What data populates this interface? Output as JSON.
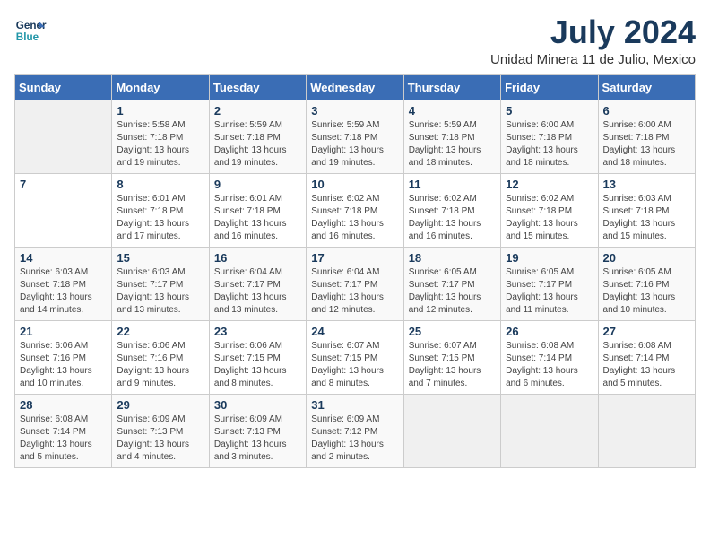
{
  "header": {
    "logo_line1": "General",
    "logo_line2": "Blue",
    "month_title": "July 2024",
    "location": "Unidad Minera 11 de Julio, Mexico"
  },
  "weekdays": [
    "Sunday",
    "Monday",
    "Tuesday",
    "Wednesday",
    "Thursday",
    "Friday",
    "Saturday"
  ],
  "weeks": [
    [
      {
        "day": "",
        "info": ""
      },
      {
        "day": "1",
        "info": "Sunrise: 5:58 AM\nSunset: 7:18 PM\nDaylight: 13 hours\nand 19 minutes."
      },
      {
        "day": "2",
        "info": "Sunrise: 5:59 AM\nSunset: 7:18 PM\nDaylight: 13 hours\nand 19 minutes."
      },
      {
        "day": "3",
        "info": "Sunrise: 5:59 AM\nSunset: 7:18 PM\nDaylight: 13 hours\nand 19 minutes."
      },
      {
        "day": "4",
        "info": "Sunrise: 5:59 AM\nSunset: 7:18 PM\nDaylight: 13 hours\nand 18 minutes."
      },
      {
        "day": "5",
        "info": "Sunrise: 6:00 AM\nSunset: 7:18 PM\nDaylight: 13 hours\nand 18 minutes."
      },
      {
        "day": "6",
        "info": "Sunrise: 6:00 AM\nSunset: 7:18 PM\nDaylight: 13 hours\nand 18 minutes."
      }
    ],
    [
      {
        "day": "7",
        "info": ""
      },
      {
        "day": "8",
        "info": "Sunrise: 6:01 AM\nSunset: 7:18 PM\nDaylight: 13 hours\nand 17 minutes."
      },
      {
        "day": "9",
        "info": "Sunrise: 6:01 AM\nSunset: 7:18 PM\nDaylight: 13 hours\nand 16 minutes."
      },
      {
        "day": "10",
        "info": "Sunrise: 6:02 AM\nSunset: 7:18 PM\nDaylight: 13 hours\nand 16 minutes."
      },
      {
        "day": "11",
        "info": "Sunrise: 6:02 AM\nSunset: 7:18 PM\nDaylight: 13 hours\nand 16 minutes."
      },
      {
        "day": "12",
        "info": "Sunrise: 6:02 AM\nSunset: 7:18 PM\nDaylight: 13 hours\nand 15 minutes."
      },
      {
        "day": "13",
        "info": "Sunrise: 6:03 AM\nSunset: 7:18 PM\nDaylight: 13 hours\nand 15 minutes."
      }
    ],
    [
      {
        "day": "14",
        "info": "Sunrise: 6:03 AM\nSunset: 7:18 PM\nDaylight: 13 hours\nand 14 minutes."
      },
      {
        "day": "15",
        "info": "Sunrise: 6:03 AM\nSunset: 7:17 PM\nDaylight: 13 hours\nand 13 minutes."
      },
      {
        "day": "16",
        "info": "Sunrise: 6:04 AM\nSunset: 7:17 PM\nDaylight: 13 hours\nand 13 minutes."
      },
      {
        "day": "17",
        "info": "Sunrise: 6:04 AM\nSunset: 7:17 PM\nDaylight: 13 hours\nand 12 minutes."
      },
      {
        "day": "18",
        "info": "Sunrise: 6:05 AM\nSunset: 7:17 PM\nDaylight: 13 hours\nand 12 minutes."
      },
      {
        "day": "19",
        "info": "Sunrise: 6:05 AM\nSunset: 7:17 PM\nDaylight: 13 hours\nand 11 minutes."
      },
      {
        "day": "20",
        "info": "Sunrise: 6:05 AM\nSunset: 7:16 PM\nDaylight: 13 hours\nand 10 minutes."
      }
    ],
    [
      {
        "day": "21",
        "info": "Sunrise: 6:06 AM\nSunset: 7:16 PM\nDaylight: 13 hours\nand 10 minutes."
      },
      {
        "day": "22",
        "info": "Sunrise: 6:06 AM\nSunset: 7:16 PM\nDaylight: 13 hours\nand 9 minutes."
      },
      {
        "day": "23",
        "info": "Sunrise: 6:06 AM\nSunset: 7:15 PM\nDaylight: 13 hours\nand 8 minutes."
      },
      {
        "day": "24",
        "info": "Sunrise: 6:07 AM\nSunset: 7:15 PM\nDaylight: 13 hours\nand 8 minutes."
      },
      {
        "day": "25",
        "info": "Sunrise: 6:07 AM\nSunset: 7:15 PM\nDaylight: 13 hours\nand 7 minutes."
      },
      {
        "day": "26",
        "info": "Sunrise: 6:08 AM\nSunset: 7:14 PM\nDaylight: 13 hours\nand 6 minutes."
      },
      {
        "day": "27",
        "info": "Sunrise: 6:08 AM\nSunset: 7:14 PM\nDaylight: 13 hours\nand 5 minutes."
      }
    ],
    [
      {
        "day": "28",
        "info": "Sunrise: 6:08 AM\nSunset: 7:14 PM\nDaylight: 13 hours\nand 5 minutes."
      },
      {
        "day": "29",
        "info": "Sunrise: 6:09 AM\nSunset: 7:13 PM\nDaylight: 13 hours\nand 4 minutes."
      },
      {
        "day": "30",
        "info": "Sunrise: 6:09 AM\nSunset: 7:13 PM\nDaylight: 13 hours\nand 3 minutes."
      },
      {
        "day": "31",
        "info": "Sunrise: 6:09 AM\nSunset: 7:12 PM\nDaylight: 13 hours\nand 2 minutes."
      },
      {
        "day": "",
        "info": ""
      },
      {
        "day": "",
        "info": ""
      },
      {
        "day": "",
        "info": ""
      }
    ]
  ]
}
